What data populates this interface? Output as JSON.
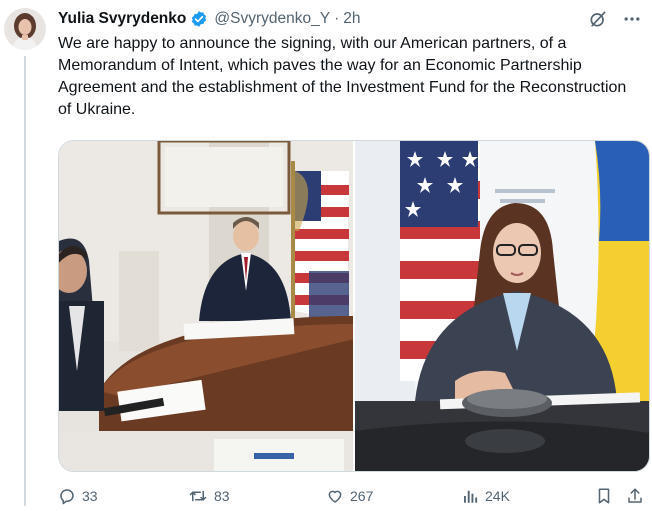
{
  "author": {
    "display_name": "Yulia Svyrydenko",
    "handle": "@Svyrydenko_Y",
    "separator": "·",
    "time": "2h",
    "verified": true,
    "verified_color": "#1d9bf0"
  },
  "tweet": {
    "text": "We are happy to announce the signing, with our American partners, of a Memorandum of Intent, which paves the way for an Economic Partnership Agreement and the establishment of the Investment Fund for the Reconstruction of Ukraine."
  },
  "media": {
    "photo_count": 2
  },
  "actions": {
    "reply_count": "33",
    "retweet_count": "83",
    "like_count": "267",
    "views_count": "24K"
  },
  "icons": {
    "reply": "reply-icon",
    "retweet": "retweet-icon",
    "like": "like-icon",
    "views": "views-icon",
    "bookmark": "bookmark-icon",
    "share": "share-icon",
    "grok": "grok-icon",
    "more": "more-icon",
    "verified": "verified-badge-icon"
  },
  "colors": {
    "text": "#0f1419",
    "secondary": "#536471",
    "accent": "#1d9bf0"
  }
}
